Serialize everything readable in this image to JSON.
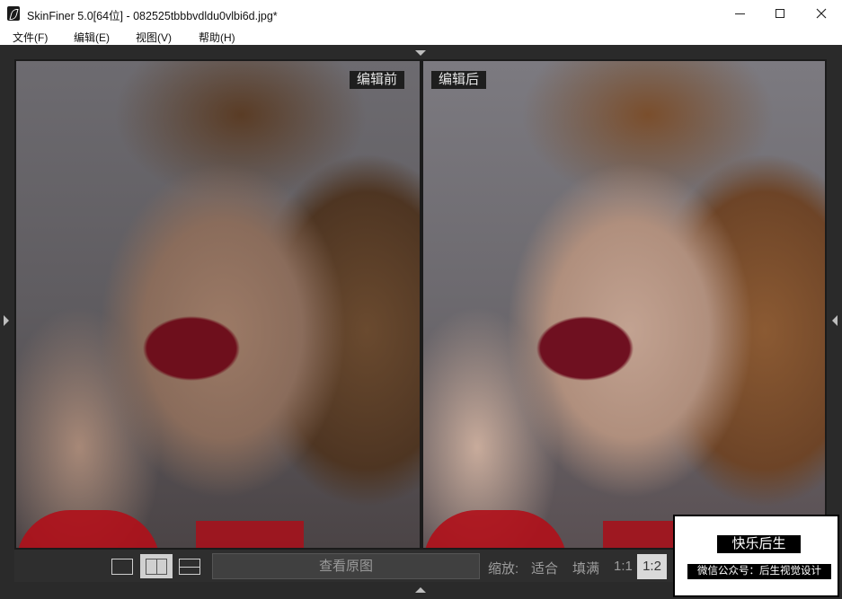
{
  "window": {
    "title": "SkinFiner 5.0[64位] - 082525tbbbvdldu0vlbi6d.jpg*",
    "minimize": "—",
    "maximize": "☐",
    "close": "✕"
  },
  "menu": [
    {
      "label": "文件(F)"
    },
    {
      "label": "编辑(E)"
    },
    {
      "label": "视图(V)"
    },
    {
      "label": "帮助(H)"
    }
  ],
  "panels": {
    "before_label": "编辑前",
    "after_label": "编辑后"
  },
  "toolbar": {
    "view_modes": [
      {
        "icon": "single-view-icon",
        "active": false
      },
      {
        "icon": "split-vertical-icon",
        "active": true
      },
      {
        "icon": "split-horizontal-icon",
        "active": false
      }
    ],
    "view_original": "查看原图",
    "zoom_label": "缩放:",
    "zoom_fit": "适合",
    "zoom_fill": "填满",
    "zoom_1_1": "1:1",
    "zoom_1_2": "1:2",
    "zoom_more": "1:"
  },
  "watermark": {
    "title": "快乐后生",
    "subtitle": "微信公众号：后生视觉设计"
  }
}
